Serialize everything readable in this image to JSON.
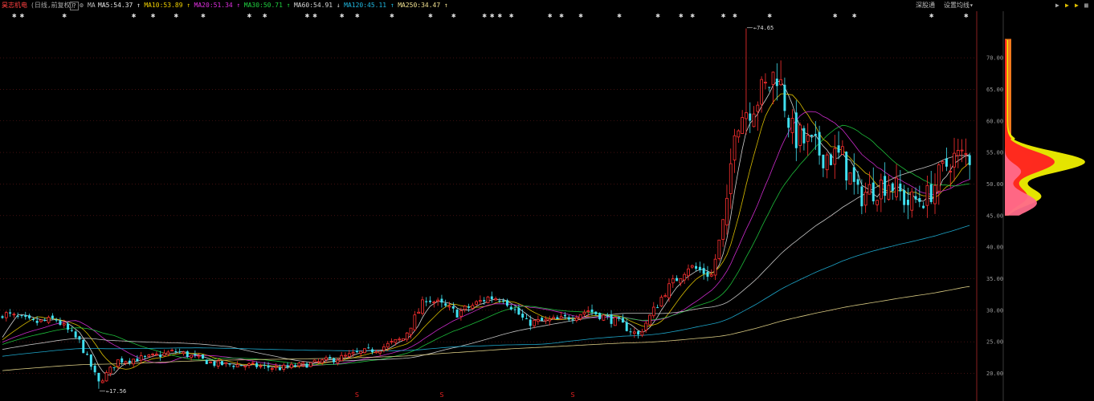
{
  "header": {
    "stock_name": "昊志机电",
    "mode": "(日线,前复权)",
    "help_label": "?",
    "settings_icon": "gear-icon",
    "ma_label": "MA",
    "ma": [
      {
        "name": "MA5",
        "value": "54.37",
        "arrow": "↑",
        "color": "#e8e8e8"
      },
      {
        "name": "MA10",
        "value": "53.89",
        "arrow": "↑",
        "color": "#f0d000"
      },
      {
        "name": "MA20",
        "value": "51.34",
        "arrow": "↑",
        "color": "#e030e0"
      },
      {
        "name": "MA30",
        "value": "50.71",
        "arrow": "↑",
        "color": "#20d040"
      },
      {
        "name": "MA60",
        "value": "54.91",
        "arrow": "↓",
        "color": "#d8d8d8"
      },
      {
        "name": "MA120",
        "value": "45.11",
        "arrow": "↑",
        "color": "#20b8e0"
      },
      {
        "name": "MA250",
        "value": "34.47",
        "arrow": "↑",
        "color": "#f0e090"
      }
    ],
    "right_links": [
      "深股通",
      "设置均线"
    ]
  },
  "toolbar_icons": [
    "play-right-icon",
    "play-yellow-icon",
    "play-yellow-icon",
    "grid-icon"
  ],
  "chart_data": {
    "type": "candlestick",
    "title": "",
    "xlabel": "",
    "ylabel": "",
    "y_ticks": [
      "70.00",
      "65.00",
      "60.00",
      "55.00",
      "50.00",
      "45.00",
      "40.00",
      "35.00",
      "30.00",
      "25.00",
      "20.00"
    ],
    "ylim": [
      16.0,
      75.6
    ],
    "grid": true,
    "annotations": [
      {
        "text": "74.65",
        "kind": "high",
        "value": 74.65,
        "index": 193
      },
      {
        "text": "17.56",
        "kind": "low",
        "value": 17.56,
        "index": 25
      }
    ],
    "s_markers": [
      "S",
      "S",
      "S"
    ],
    "top_markers": "*, ✱, ⇞ event flags above candles",
    "series": [
      {
        "name": "MA5",
        "color": "#e8e8e8"
      },
      {
        "name": "MA10",
        "color": "#f0d000"
      },
      {
        "name": "MA20",
        "color": "#e030e0"
      },
      {
        "name": "MA30",
        "color": "#20d040"
      },
      {
        "name": "MA60",
        "color": "#d8d8d8"
      },
      {
        "name": "MA120",
        "color": "#20b8e0"
      },
      {
        "name": "MA250",
        "color": "#f0e090"
      }
    ],
    "anchor_closes": [
      [
        0,
        29.5
      ],
      [
        8,
        28.0
      ],
      [
        14,
        28.5
      ],
      [
        20,
        25.0
      ],
      [
        25,
        18.5
      ],
      [
        30,
        22.0
      ],
      [
        38,
        22.5
      ],
      [
        45,
        23.5
      ],
      [
        55,
        21.5
      ],
      [
        65,
        21.2
      ],
      [
        72,
        20.8
      ],
      [
        80,
        21.5
      ],
      [
        88,
        22.5
      ],
      [
        98,
        24.0
      ],
      [
        104,
        25.5
      ],
      [
        110,
        32.0
      ],
      [
        118,
        29.5
      ],
      [
        126,
        32.0
      ],
      [
        130,
        32.0
      ],
      [
        136,
        28.0
      ],
      [
        145,
        28.5
      ],
      [
        152,
        30.0
      ],
      [
        160,
        28.0
      ],
      [
        165,
        26.0
      ],
      [
        172,
        33.0
      ],
      [
        178,
        37.0
      ],
      [
        184,
        35.5
      ],
      [
        188,
        46.0
      ],
      [
        190,
        60.0
      ],
      [
        194,
        62.5
      ],
      [
        198,
        65.0
      ],
      [
        201,
        68.0
      ],
      [
        205,
        58.0
      ],
      [
        212,
        55.0
      ],
      [
        218,
        54.0
      ],
      [
        222,
        48.0
      ],
      [
        230,
        50.5
      ],
      [
        235,
        47.0
      ],
      [
        240,
        48.0
      ],
      [
        246,
        54.0
      ],
      [
        250,
        54.4
      ]
    ],
    "volume_profile": {
      "colors": [
        "#f0f000",
        "#ff2020",
        "#ff6a8a",
        "#ff8020"
      ],
      "peak_price": 53.5,
      "range": [
        45.0,
        73.0
      ]
    }
  }
}
